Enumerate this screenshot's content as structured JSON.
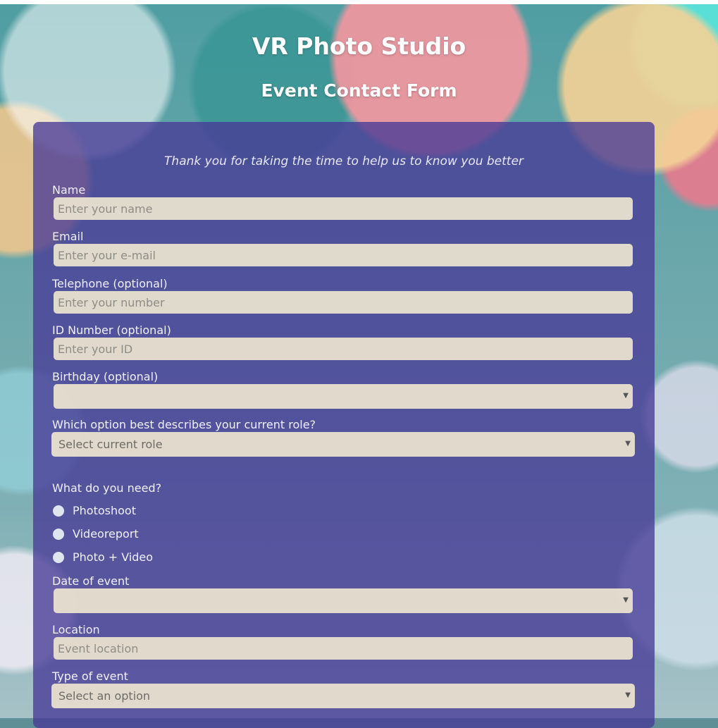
{
  "header": {
    "title": "VR Photo Studio",
    "subtitle": "Event Contact Form"
  },
  "form": {
    "intro": "Thank you for taking the time to help us to know you better",
    "name": {
      "label": "Name",
      "placeholder": "Enter your name"
    },
    "email": {
      "label": "Email",
      "placeholder": "Enter your e-mail"
    },
    "telephone": {
      "label": "Telephone (optional)",
      "placeholder": "Enter your number"
    },
    "id_number": {
      "label": "ID Number (optional)",
      "placeholder": "Enter your ID"
    },
    "birthday": {
      "label": "Birthday (optional)",
      "value": ""
    },
    "role": {
      "label": "Which option best describes your current role?",
      "value": "Select current role"
    },
    "need": {
      "label": "What do you need?",
      "options": [
        "Photoshoot",
        "Videoreport",
        "Photo + Video"
      ]
    },
    "date": {
      "label": "Date of event",
      "value": ""
    },
    "location": {
      "label": "Location",
      "placeholder": "Event location"
    },
    "type": {
      "label": "Type of event",
      "value": "Select an option"
    }
  },
  "icons": {
    "dropdown": "chevron-down-icon",
    "radio": "radio-button-icon"
  }
}
